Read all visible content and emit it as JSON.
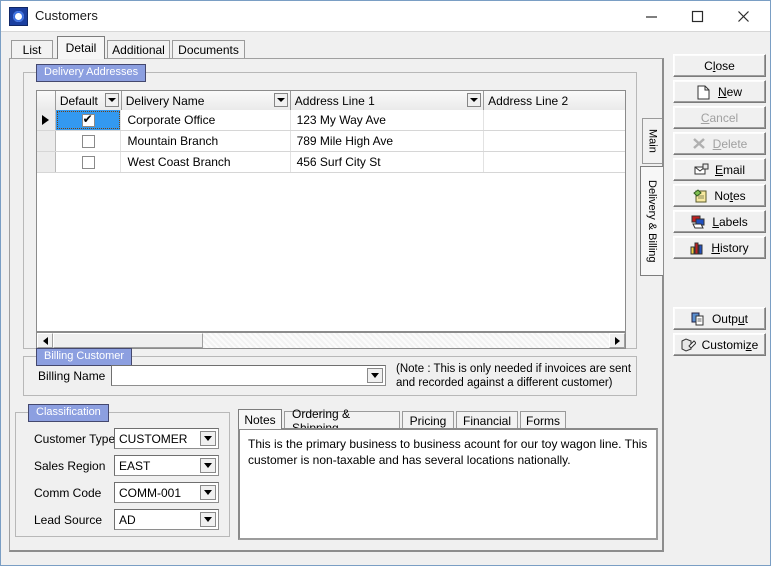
{
  "window": {
    "title": "Customers",
    "icon": "app-eye-icon",
    "controls": {
      "minimize": "minimize-icon",
      "maximize": "maximize-icon",
      "close": "close-icon"
    }
  },
  "tabs": [
    {
      "label": "List",
      "active": false
    },
    {
      "label": "Detail",
      "active": true
    },
    {
      "label": "Additional",
      "active": false
    },
    {
      "label": "Documents",
      "active": false
    }
  ],
  "vertical_tabs": [
    {
      "label": "Main",
      "active": false
    },
    {
      "label": "Delivery & Billing",
      "active": true
    }
  ],
  "delivery": {
    "group_label": "Delivery Addresses",
    "columns": [
      "Default",
      "Delivery Name",
      "Address Line 1",
      "Address Line 2"
    ],
    "rows": [
      {
        "selected": true,
        "default": true,
        "name": "Corporate Office",
        "address1": "123 My Way Ave",
        "address2": ""
      },
      {
        "selected": false,
        "default": false,
        "name": "Mountain Branch",
        "address1": "789 Mile High Ave",
        "address2": ""
      },
      {
        "selected": false,
        "default": false,
        "name": "West Coast Branch",
        "address1": "456 Surf City St",
        "address2": ""
      }
    ],
    "scroll": {
      "left_arrow": "scroll-left-icon",
      "right_arrow": "scroll-right-icon"
    }
  },
  "billing": {
    "group_label": "Billing Customer",
    "name_label": "Billing Name",
    "name_value": "",
    "note_line1": "(Note : This is only needed if invoices are sent",
    "note_line2": "and recorded against a different customer)"
  },
  "classification": {
    "group_label": "Classification",
    "fields": [
      {
        "label": "Customer Type",
        "value": "CUSTOMER"
      },
      {
        "label": "Sales Region",
        "value": "EAST"
      },
      {
        "label": "Comm Code",
        "value": "COMM-001"
      },
      {
        "label": "Lead Source",
        "value": "AD"
      }
    ]
  },
  "notes_panel": {
    "tabs": [
      {
        "label": "Notes",
        "active": true
      },
      {
        "label": "Ordering & Shipping",
        "active": false
      },
      {
        "label": "Pricing",
        "active": false
      },
      {
        "label": "Financial",
        "active": false
      },
      {
        "label": "Forms",
        "active": false
      }
    ],
    "text": "This is the primary business to business acount for our toy wagon line.  This customer is non-taxable and has several locations nationally."
  },
  "buttons": {
    "group1": [
      {
        "name": "close",
        "pre": "C",
        "key": "l",
        "post": "ose",
        "icon": null,
        "disabled": false
      },
      {
        "name": "new",
        "pre": "",
        "key": "N",
        "post": "ew",
        "icon": "page-icon",
        "disabled": false
      },
      {
        "name": "cancel",
        "pre": "",
        "key": "C",
        "post": "ancel",
        "icon": null,
        "disabled": true
      },
      {
        "name": "delete",
        "pre": "",
        "key": "D",
        "post": "elete",
        "icon": "x-icon",
        "disabled": true
      },
      {
        "name": "email",
        "pre": "",
        "key": "E",
        "post": "mail",
        "icon": "envelope-icon",
        "disabled": false
      },
      {
        "name": "notes",
        "pre": "No",
        "key": "t",
        "post": "es",
        "icon": "notepad-icon",
        "disabled": false
      },
      {
        "name": "labels",
        "pre": "",
        "key": "L",
        "post": "abels",
        "icon": "labels-icon",
        "disabled": false
      },
      {
        "name": "history",
        "pre": "",
        "key": "H",
        "post": "istory",
        "icon": "chart-icon",
        "disabled": false
      }
    ],
    "group2": [
      {
        "name": "output",
        "pre": "Outp",
        "key": "u",
        "post": "t",
        "icon": "output-icon",
        "disabled": false
      },
      {
        "name": "customize",
        "pre": "Customi",
        "key": "z",
        "post": "e",
        "icon": "customize-icon",
        "disabled": false
      }
    ]
  },
  "colors": {
    "group_label_bg": "#8c9fe0",
    "row_selected": "#3399f0",
    "window_bg": "#f0f0f0",
    "frame": "#7a9ec4"
  }
}
